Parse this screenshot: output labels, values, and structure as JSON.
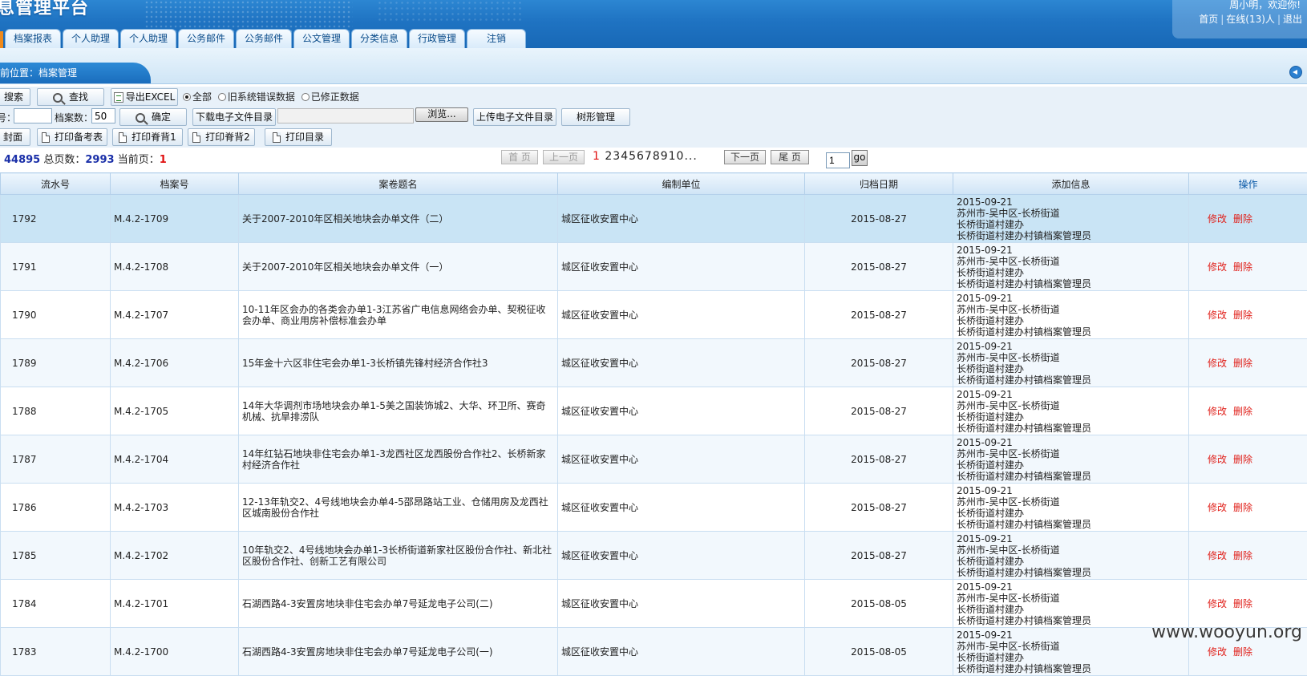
{
  "header": {
    "logo_text": "息管理平台",
    "welcome": "周小明，欢迎你!",
    "links": [
      "首页",
      "在线(13)人",
      "退出"
    ],
    "separator": "|"
  },
  "nav": {
    "tabs": [
      "档案报表",
      "个人助理",
      "个人助理",
      "公务邮件",
      "公务邮件",
      "公文管理",
      "分类信息",
      "行政管理",
      "注销"
    ]
  },
  "breadcrumb": {
    "text": "前位置：档案管理"
  },
  "toolbar1": {
    "search": "搜索",
    "find": "查找",
    "export": "导出EXCEL",
    "radios": [
      {
        "label": "全部",
        "checked": true
      },
      {
        "label": "旧系统错误数据",
        "checked": false
      },
      {
        "label": "已修正数据",
        "checked": false
      }
    ]
  },
  "toolbar2": {
    "label1": "号：",
    "label2": "档案数：",
    "count_value": "50",
    "confirm": "确定",
    "download": "下载电子文件目录",
    "browse": "浏览...",
    "upload": "上传电子文件目录",
    "tree": "树形管理"
  },
  "toolbar3": {
    "buttons": [
      "封面",
      "打印备考表",
      "打印脊背1",
      "打印脊背2",
      "打印目录"
    ]
  },
  "pager": {
    "total_records": "44895",
    "total_pages_label": "总页数：",
    "total_pages": "2993",
    "current_label": "当前页：",
    "current": "1",
    "first": "首 页",
    "prev": "上一页",
    "next": "下一页",
    "last": "尾 页",
    "pages_current": "1",
    "pages_rest": "2345678910",
    "ellipsis": "...",
    "goto_value": "1",
    "go": "go"
  },
  "table": {
    "columns": [
      "流水号",
      "档案号",
      "案卷题名",
      "编制单位",
      "归档日期",
      "添加信息",
      "操作"
    ],
    "edit_label": "修改",
    "delete_label": "删除",
    "rows": [
      {
        "serial": "1792",
        "archive_no": "M.4.2-1709",
        "title": "关于2007-2010年区相关地块会办单文件（二）",
        "unit": "城区征收安置中心",
        "date": "2015-08-27",
        "info": [
          "2015-09-21",
          "苏州市-吴中区-长桥街道",
          "长桥街道村建办",
          "长桥街道村建办村镇档案管理员"
        ]
      },
      {
        "serial": "1791",
        "archive_no": "M.4.2-1708",
        "title": "关于2007-2010年区相关地块会办单文件（一）",
        "unit": "城区征收安置中心",
        "date": "2015-08-27",
        "info": [
          "2015-09-21",
          "苏州市-吴中区-长桥街道",
          "长桥街道村建办",
          "长桥街道村建办村镇档案管理员"
        ]
      },
      {
        "serial": "1790",
        "archive_no": "M.4.2-1707",
        "title": "10-11年区会办的各类会办单1-3江苏省广电信息网络会办单、契税征收会办单、商业用房补偿标准会办单",
        "unit": "城区征收安置中心",
        "date": "2015-08-27",
        "info": [
          "2015-09-21",
          "苏州市-吴中区-长桥街道",
          "长桥街道村建办",
          "长桥街道村建办村镇档案管理员"
        ]
      },
      {
        "serial": "1789",
        "archive_no": "M.4.2-1706",
        "title": "15年金十六区非住宅会办单1-3长桥镇先锋村经济合作社3",
        "unit": "城区征收安置中心",
        "date": "2015-08-27",
        "info": [
          "2015-09-21",
          "苏州市-吴中区-长桥街道",
          "长桥街道村建办",
          "长桥街道村建办村镇档案管理员"
        ]
      },
      {
        "serial": "1788",
        "archive_no": "M.4.2-1705",
        "title": "14年大华调剂市场地块会办单1-5美之国装饰城2、大华、环卫所、赛奇机械、抗旱排涝队",
        "unit": "城区征收安置中心",
        "date": "2015-08-27",
        "info": [
          "2015-09-21",
          "苏州市-吴中区-长桥街道",
          "长桥街道村建办",
          "长桥街道村建办村镇档案管理员"
        ]
      },
      {
        "serial": "1787",
        "archive_no": "M.4.2-1704",
        "title": "14年红钻石地块非住宅会办单1-3龙西社区龙西股份合作社2、长桥新家村经济合作社",
        "unit": "城区征收安置中心",
        "date": "2015-08-27",
        "info": [
          "2015-09-21",
          "苏州市-吴中区-长桥街道",
          "长桥街道村建办",
          "长桥街道村建办村镇档案管理员"
        ]
      },
      {
        "serial": "1786",
        "archive_no": "M.4.2-1703",
        "title": "12-13年轨交2、4号线地块会办单4-5邵昂路站工业、仓储用房及龙西社区城南股份合作社",
        "unit": "城区征收安置中心",
        "date": "2015-08-27",
        "info": [
          "2015-09-21",
          "苏州市-吴中区-长桥街道",
          "长桥街道村建办",
          "长桥街道村建办村镇档案管理员"
        ]
      },
      {
        "serial": "1785",
        "archive_no": "M.4.2-1702",
        "title": "10年轨交2、4号线地块会办单1-3长桥街道新家社区股份合作社、新北社区股份合作社、创新工艺有限公司",
        "unit": "城区征收安置中心",
        "date": "2015-08-27",
        "info": [
          "2015-09-21",
          "苏州市-吴中区-长桥街道",
          "长桥街道村建办",
          "长桥街道村建办村镇档案管理员"
        ]
      },
      {
        "serial": "1784",
        "archive_no": "M.4.2-1701",
        "title": "石湖西路4-3安置房地块非住宅会办单7号延龙电子公司(二)",
        "unit": "城区征收安置中心",
        "date": "2015-08-05",
        "info": [
          "2015-09-21",
          "苏州市-吴中区-长桥街道",
          "长桥街道村建办",
          "长桥街道村建办村镇档案管理员"
        ]
      },
      {
        "serial": "1783",
        "archive_no": "M.4.2-1700",
        "title": "石湖西路4-3安置房地块非住宅会办单7号延龙电子公司(一)",
        "unit": "城区征收安置中心",
        "date": "2015-08-05",
        "info": [
          "2015-09-21",
          "苏州市-吴中区-长桥街道",
          "长桥街道村建办",
          "长桥街道村建办村镇档案管理员"
        ]
      }
    ]
  },
  "watermark": "www.wooyun.org"
}
